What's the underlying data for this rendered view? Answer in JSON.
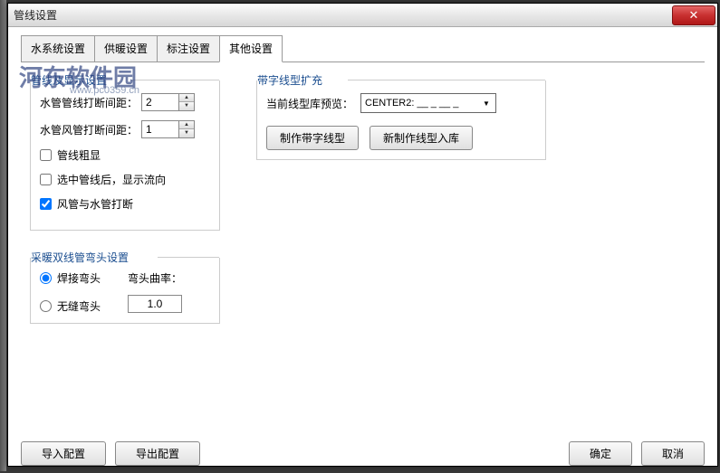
{
  "window": {
    "title": "管线设置"
  },
  "watermark": {
    "main": "河东软件园",
    "sub": "www.pc0359.cn"
  },
  "tabs": {
    "t1": "水系统设置",
    "t2": "供暖设置",
    "t3": "标注设置",
    "t4": "其他设置"
  },
  "section1": {
    "title": "管线及显示设置",
    "row1_label": "水管管线打断间距：",
    "row1_value": "2",
    "row2_label": "水管风管打断间距：",
    "row2_value": "1",
    "chk1": "管线粗显",
    "chk2": "选中管线后，显示流向",
    "chk3": "风管与水管打断"
  },
  "section2": {
    "title": "采暖双线管弯头设置",
    "r1": "焊接弯头",
    "r2": "无缝弯头",
    "curv_label": "弯头曲率：",
    "curv_value": "1.0"
  },
  "section3": {
    "title": "带字线型扩充",
    "preview_label": "当前线型库预览：",
    "preview_value": "CENTER2: __ _ __ _",
    "btn1": "制作带字线型",
    "btn2": "新制作线型入库"
  },
  "footer": {
    "import": "导入配置",
    "export": "导出配置",
    "ok": "确定",
    "cancel": "取消"
  }
}
